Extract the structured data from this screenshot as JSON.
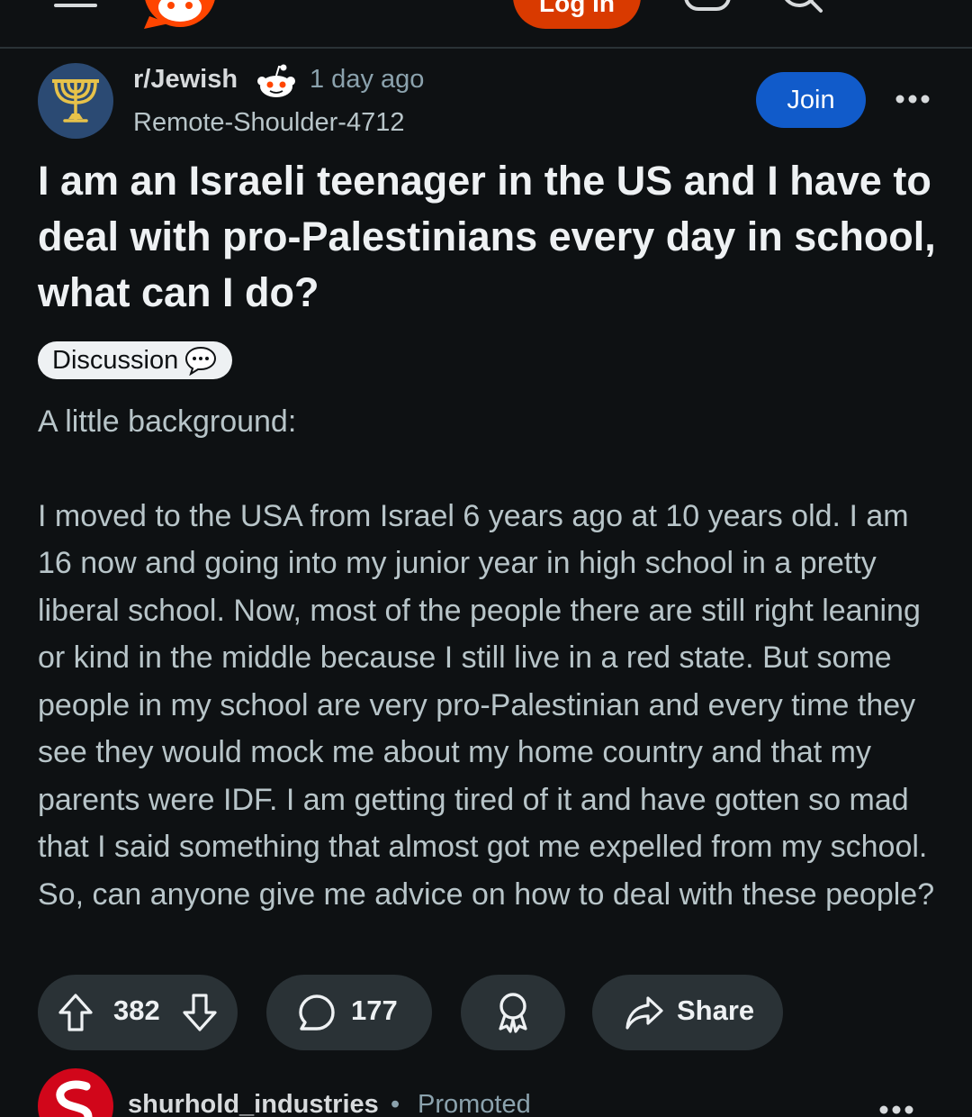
{
  "topbar": {
    "login_label": "Log In"
  },
  "post": {
    "subreddit": "r/Jewish",
    "time_ago": "1 day ago",
    "author": "Remote-Shoulder-4712",
    "join_label": "Join",
    "title": "I am an Israeli teenager in the US and I have to deal with pro-Palestinians every day in school, what can I do?",
    "flair": "Discussion",
    "body": [
      "A little background:",
      "I moved to the USA from Israel 6 years ago at 10 years old. I am 16 now and going into my junior year in high school in a pretty liberal school. Now, most of the people there are still right leaning or kind in the middle because I still live in a red state. But some people in my school are very pro-Palestinian and every time they see they would mock me about my home country and that my parents were IDF. I am getting tired of it and have gotten so mad that I said something that almost got me expelled from my school. So, can anyone give me advice on how to deal with these people?"
    ],
    "upvotes": "382",
    "comments": "177",
    "share_label": "Share"
  },
  "next_post": {
    "advertiser": "shurhold_industries",
    "separator": "•",
    "promoted_label": "Promoted"
  },
  "colors": {
    "background": "#0e1113",
    "join_button": "#115bca",
    "login_button": "#d93a00",
    "pill_background": "#2a3236"
  },
  "icons": [
    "menu-icon",
    "reddit-logo-icon",
    "chat-icon",
    "search-icon",
    "snoo-icon",
    "menorah-icon",
    "more-icon",
    "speech-bubble-icon",
    "upvote-icon",
    "downvote-icon",
    "comment-icon",
    "award-icon",
    "share-icon"
  ]
}
